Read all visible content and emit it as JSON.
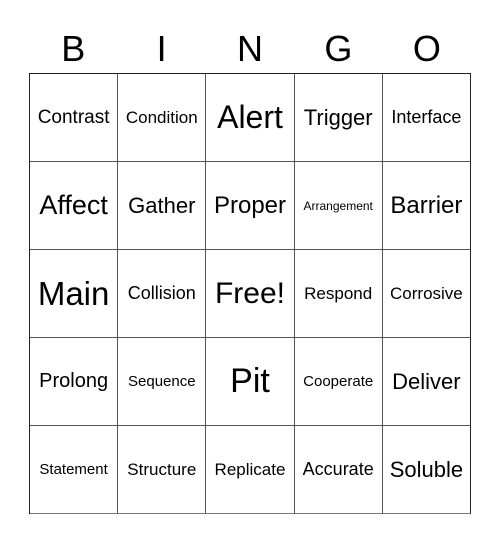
{
  "header": {
    "letters": [
      "B",
      "I",
      "N",
      "G",
      "O"
    ]
  },
  "cells": [
    {
      "word": "Contrast",
      "size": 19
    },
    {
      "word": "Condition",
      "size": 17
    },
    {
      "word": "Alert",
      "size": 32
    },
    {
      "word": "Trigger",
      "size": 22
    },
    {
      "word": "Interface",
      "size": 18
    },
    {
      "word": "Affect",
      "size": 27
    },
    {
      "word": "Gather",
      "size": 22
    },
    {
      "word": "Proper",
      "size": 24
    },
    {
      "word": "Arrangement",
      "size": 12
    },
    {
      "word": "Barrier",
      "size": 24
    },
    {
      "word": "Main",
      "size": 33
    },
    {
      "word": "Collision",
      "size": 18
    },
    {
      "word": "Free!",
      "size": 30
    },
    {
      "word": "Respond",
      "size": 17
    },
    {
      "word": "Corrosive",
      "size": 17
    },
    {
      "word": "Prolong",
      "size": 20
    },
    {
      "word": "Sequence",
      "size": 15
    },
    {
      "word": "Pit",
      "size": 34
    },
    {
      "word": "Cooperate",
      "size": 15
    },
    {
      "word": "Deliver",
      "size": 22
    },
    {
      "word": "Statement",
      "size": 15
    },
    {
      "word": "Structure",
      "size": 17
    },
    {
      "word": "Replicate",
      "size": 17
    },
    {
      "word": "Accurate",
      "size": 18
    },
    {
      "word": "Soluble",
      "size": 22
    }
  ]
}
